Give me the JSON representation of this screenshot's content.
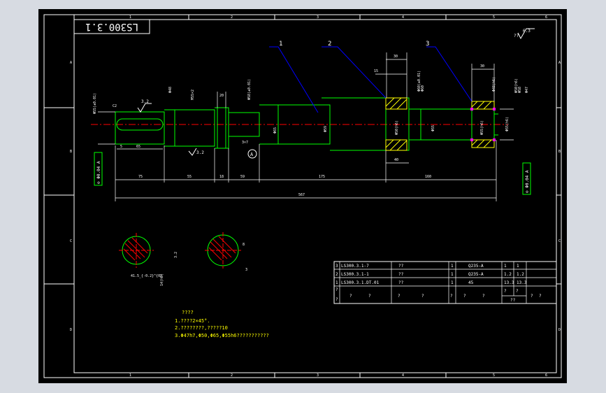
{
  "title_block_code": "LS300.3.1",
  "roughness": {
    "global": "6.3",
    "global_prefix": "??",
    "keyway": "3.2",
    "shoulder": "3.2"
  },
  "balloons": [
    "1",
    "2",
    "3"
  ],
  "grid_letters": [
    "A",
    "B",
    "C",
    "D"
  ],
  "grid_numbers": [
    "1",
    "2",
    "3",
    "4",
    "5",
    "6"
  ],
  "datum": "A",
  "tolerance_frames": {
    "left": "⊙ Φ0.04 A",
    "right": "⊙ Φ0.04 A"
  },
  "dimensions": {
    "overall": "567",
    "seg_75": "75",
    "seg_55": "55",
    "seg_18": "18",
    "seg_59": "59",
    "seg_175": "175",
    "seg_160": "160",
    "key_5": "5",
    "key_65": "65",
    "w_30a": "30",
    "w_15": "15",
    "w_30b": "30",
    "w_40": "40",
    "w_20": "20",
    "d_65": "Φ65",
    "d_59": "Φ59",
    "d_55": "Φ55",
    "d_60": "Φ60",
    "d_58": "Φ58",
    "d_48": "Φ48",
    "fit_1": "Φ50(h6)",
    "fit_2": "Φ55(h6)",
    "fit_3": "Φ55(h6)",
    "thread": "M55×2",
    "chamfer": "3×7",
    "edge_c": "C2",
    "d_47": "Φ47",
    "tol_top_1": "Φ55(±0.01)",
    "tol_top_2": "Φ58(±0.01)",
    "tol_top_3": "Φ60(±0.01)",
    "tol_top_4": "Φ48(h6)",
    "tol_top_5": "Φ50(h6)"
  },
  "sections": {
    "sec1_dim_a": "14(h8)",
    "sec1_dim_b": "41.5_{-0.2}^{0}",
    "sec1_dim_c": "3.2",
    "sec2_dim_a": "8",
    "sec2_dim_b": "3"
  },
  "bom": {
    "rows": [
      [
        "3",
        "LS300.3.1-7",
        "??",
        "1",
        "Q235-A",
        "1",
        "1"
      ],
      [
        "2",
        "LS300.3.1-1",
        "??",
        "1",
        "Q235-A",
        "1.2",
        "1.2"
      ],
      [
        "1",
        "LS300.3.1.DT.01",
        "??",
        "1",
        "45",
        "13.3",
        "13.3"
      ]
    ],
    "header_left": [
      "?",
      "?"
    ],
    "header_cells": [
      "?",
      "?",
      "?",
      "?",
      "?",
      "?",
      "?",
      "?",
      "?",
      "?"
    ],
    "header_mid": "??"
  },
  "notes": {
    "title": "????",
    "line1": "1.????2×45°.",
    "line2": "2.????????,?????10",
    "line3": "3.Φ47h7,Φ50,Φ65,Φ55h6???????????"
  },
  "colors": {
    "frame": "#ffffff",
    "geometry": "#00ff00",
    "dims": "#ffffff",
    "leader": "#0000ff",
    "hatch": "#ffff00",
    "center": "#ff0000",
    "note": "#ffff00",
    "grip": "#ff00ff"
  }
}
